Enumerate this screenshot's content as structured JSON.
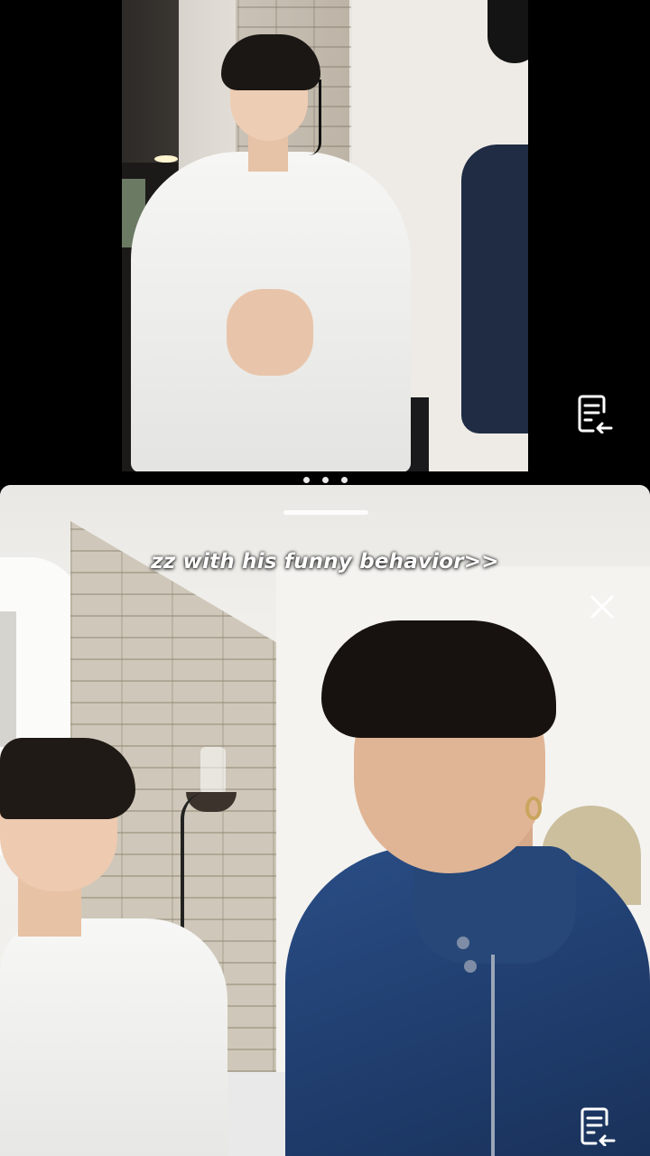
{
  "top_stream": {
    "notes_icon": "document-back-arrow-icon"
  },
  "pager": {
    "dot_count": 3
  },
  "bottom_stream": {
    "caption": "zz with his funny behavior>>",
    "close_icon": "close-icon",
    "notes_icon": "document-back-arrow-icon"
  }
}
